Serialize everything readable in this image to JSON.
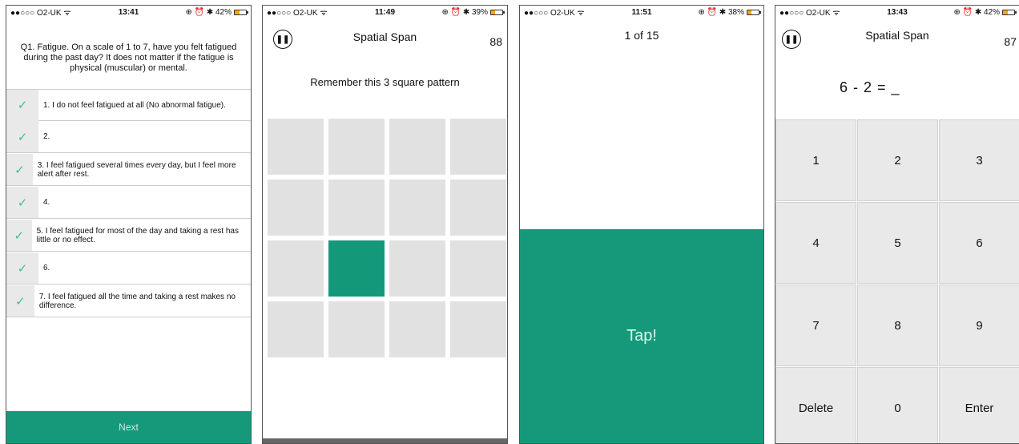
{
  "phones": [
    {
      "status": {
        "carrier": "●●○○○ O2-UK ᯤ",
        "time": "13:41",
        "right": "⊕ ⏰ ✱ 42%",
        "battery": 0.42,
        "battery_color": "#f5a623"
      },
      "question": "Q1. Fatigue. On a scale of 1 to 7, have you felt fatigued during the past day? It does not matter if the fatigue is physical (muscular) or mental.",
      "options": [
        "1. I do not feel fatigued at all (No abnormal fatigue).",
        "2.",
        "3. I feel fatigued several times every day, but I feel more alert after rest.",
        "4.",
        "5. I feel fatigued for most of the day and taking a rest has little or no effect.",
        "6.",
        "7. I feel fatigued all the time and taking a rest makes no difference."
      ],
      "next_label": "Next",
      "check_icon": "checkmark-icon"
    },
    {
      "status": {
        "carrier": "●●○○○ O2-UK ᯤ",
        "time": "11:49",
        "right": "⊕ ⏰ ✱ 39%",
        "battery": 0.39
      },
      "title": "Spatial Span",
      "score": "88",
      "instruction": "Remember this 3 square pattern",
      "active_cell": 9,
      "accent": "#14987a"
    },
    {
      "status": {
        "carrier": "●●○○○ O2-UK ᯤ",
        "time": "11:51",
        "right": "⊕ ⏰ ✱ 38%",
        "battery": 0.38
      },
      "counter": "1 of 15",
      "tap_label": "Tap!"
    },
    {
      "status": {
        "carrier": "●●○○○ O2-UK ᯤ",
        "time": "13:43",
        "right": "⊕ ⏰ ✱ 42%",
        "battery": 0.42
      },
      "title": "Spatial Span",
      "score": "87",
      "equation": "6 - 2 =  _",
      "keys": [
        "1",
        "2",
        "3",
        "4",
        "5",
        "6",
        "7",
        "8",
        "9",
        "Delete",
        "0",
        "Enter"
      ]
    }
  ]
}
